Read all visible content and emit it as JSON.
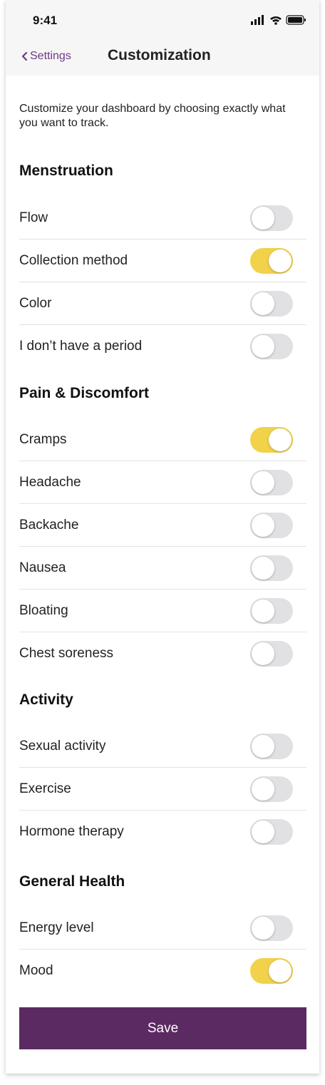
{
  "status_bar": {
    "time": "9:41"
  },
  "nav": {
    "back_label": "Settings",
    "title": "Customization"
  },
  "intro": "Customize your dashboard by choosing exactly what you want to track.",
  "sections": [
    {
      "title": "Menstruation",
      "items": [
        {
          "label": "Flow",
          "enabled": false
        },
        {
          "label": "Collection method",
          "enabled": true
        },
        {
          "label": "Color",
          "enabled": false
        },
        {
          "label": "I don’t have a period",
          "enabled": false
        }
      ]
    },
    {
      "title": "Pain & Discomfort",
      "items": [
        {
          "label": "Cramps",
          "enabled": true
        },
        {
          "label": "Headache",
          "enabled": false
        },
        {
          "label": "Backache",
          "enabled": false
        },
        {
          "label": "Nausea",
          "enabled": false
        },
        {
          "label": "Bloating",
          "enabled": false
        },
        {
          "label": "Chest soreness",
          "enabled": false
        }
      ]
    },
    {
      "title": "Activity",
      "items": [
        {
          "label": "Sexual activity",
          "enabled": false
        },
        {
          "label": "Exercise",
          "enabled": false
        },
        {
          "label": "Hormone therapy",
          "enabled": false
        }
      ]
    },
    {
      "title": "General Health",
      "items": [
        {
          "label": "Energy level",
          "enabled": false
        },
        {
          "label": "Mood",
          "enabled": true
        }
      ]
    }
  ],
  "save_label": "Save",
  "colors": {
    "accent": "#6b3a86",
    "toggle_on": "#f2d14b",
    "toggle_off": "#e1e1e4",
    "save_bg": "#5b2a62"
  }
}
